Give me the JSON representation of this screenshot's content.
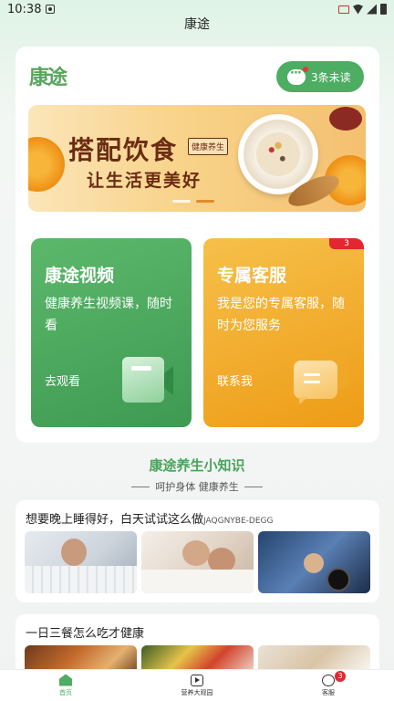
{
  "status_bar": {
    "time": "10:38"
  },
  "header": {
    "title": "康途"
  },
  "top": {
    "logo_text": "康途",
    "unread_label": "3条未读",
    "banner": {
      "title": "搭配饮食",
      "tag": "健康养生",
      "subtitle": "让生活更美好"
    }
  },
  "cards": {
    "video": {
      "title": "康途视频",
      "desc": "健康养生视频课，随时看",
      "action": "去观看"
    },
    "service": {
      "title": "专属客服",
      "desc": "我是您的专属客服，随时为您服务",
      "action": "联系我",
      "badge": "3"
    }
  },
  "section": {
    "title": "康途养生小知识",
    "subtitle": "呵护身体 健康养生"
  },
  "articles": [
    {
      "title": "想要晚上睡得好，白天试试这么做",
      "code": "JAQGNYBE-DEGG"
    },
    {
      "title": "一日三餐怎么吃才健康"
    }
  ],
  "bottom_nav": {
    "items": [
      {
        "label": "首页",
        "icon": "home-icon",
        "active": true
      },
      {
        "label": "营养大观园",
        "icon": "tv-icon"
      },
      {
        "label": "客服",
        "icon": "chat-icon",
        "badge": "3"
      }
    ]
  },
  "colors": {
    "accent_green": "#4cad63",
    "accent_orange": "#ee9c16",
    "badge_red": "#e3262f"
  }
}
